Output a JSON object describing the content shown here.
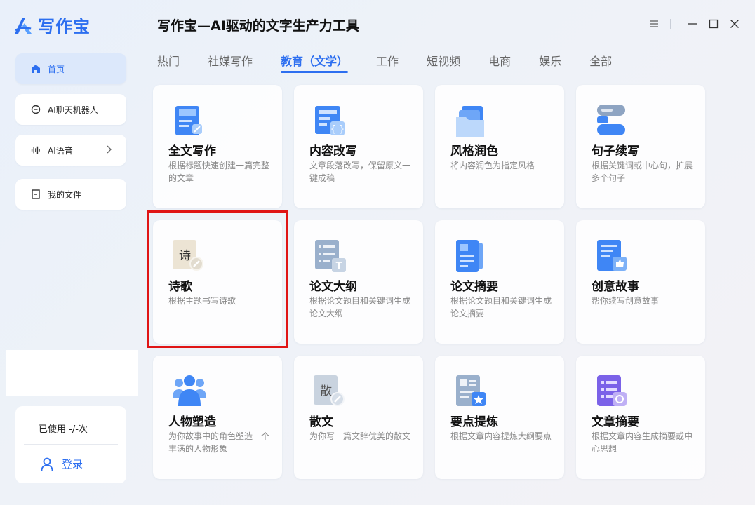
{
  "app": {
    "logo_text": "写作宝",
    "window_title": "写作宝—AI驱动的文字生产力工具"
  },
  "sidebar": {
    "items": [
      {
        "label": "首页",
        "icon": "home-icon",
        "active": true
      },
      {
        "label": "AI聊天机器人",
        "icon": "chat-bubble-icon"
      },
      {
        "label": "AI语音",
        "icon": "audio-wave-icon",
        "has_chevron": true
      },
      {
        "label": "我的文件",
        "icon": "file-icon"
      }
    ],
    "usage_text": "已使用 -/-次",
    "login_label": "登录"
  },
  "tabs": [
    {
      "label": "热门"
    },
    {
      "label": "社媒写作"
    },
    {
      "label": "教育（文学）",
      "active": true
    },
    {
      "label": "工作"
    },
    {
      "label": "短视频"
    },
    {
      "label": "电商"
    },
    {
      "label": "娱乐"
    },
    {
      "label": "全部"
    }
  ],
  "cards": [
    {
      "title": "全文写作",
      "desc": "根据标题快速创建一篇完整的文章",
      "icon": "document-pen-icon"
    },
    {
      "title": "内容改写",
      "desc": "文章段落改写，保留原义一键成稿",
      "icon": "document-braces-icon"
    },
    {
      "title": "风格润色",
      "desc": "将内容润色为指定风格",
      "icon": "folder-stack-icon"
    },
    {
      "title": "句子续写",
      "desc": "根据关键词或中心句，扩展多个句子",
      "icon": "sentence-blocks-icon"
    },
    {
      "title": "诗歌",
      "desc": "根据主题书写诗歌",
      "icon": "poem-scroll-icon",
      "icon_char": "诗"
    },
    {
      "title": "论文大纲",
      "desc": "根据论文题目和关键词生成论文大纲",
      "icon": "outline-list-icon"
    },
    {
      "title": "论文摘要",
      "desc": "根据论文题目和关键词生成论文摘要",
      "icon": "paper-summary-icon"
    },
    {
      "title": "创意故事",
      "desc": "帮你续写创意故事",
      "icon": "story-thumb-icon"
    },
    {
      "title": "人物塑造",
      "desc": "为你故事中的角色塑造一个丰满的人物形象",
      "icon": "people-group-icon"
    },
    {
      "title": "散文",
      "desc": "为你写一篇文辞优美的散文",
      "icon": "prose-scroll-icon",
      "icon_char": "散"
    },
    {
      "title": "要点提炼",
      "desc": "根据文章内容提炼大纲要点",
      "icon": "key-points-icon"
    },
    {
      "title": "文章摘要",
      "desc": "根据文章内容生成摘要或中心思想",
      "icon": "article-summary-icon"
    }
  ],
  "colors": {
    "accent": "#2d6ff0",
    "highlight": "#e01515"
  }
}
